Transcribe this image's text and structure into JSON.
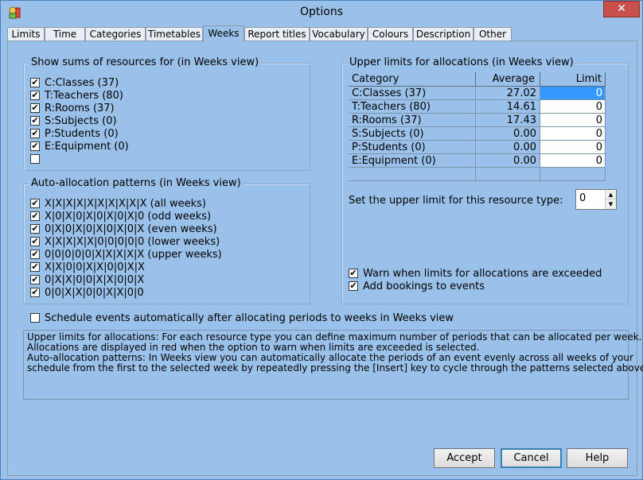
{
  "window": {
    "title": "Options",
    "close_glyph": "✕"
  },
  "tabs": [
    "Limits",
    "Time",
    "Categories",
    "Timetables",
    "Weeks",
    "Report titles",
    "Vocabulary",
    "Colours",
    "Description",
    "Other"
  ],
  "active_tab": "Weeks",
  "sums_group": {
    "title": "Show sums of resources for (in Weeks view)",
    "items": [
      {
        "label": "C:Classes (37)",
        "checked": true
      },
      {
        "label": "T:Teachers (80)",
        "checked": true
      },
      {
        "label": "R:Rooms (37)",
        "checked": true
      },
      {
        "label": "S:Subjects (0)",
        "checked": true
      },
      {
        "label": "P:Students (0)",
        "checked": true
      },
      {
        "label": "E:Equipment (0)",
        "checked": true
      },
      {
        "label": "",
        "checked": false
      }
    ]
  },
  "patterns_group": {
    "title": "Auto-allocation patterns (in Weeks view)",
    "items": [
      {
        "label": "X|X|X|X|X|X|X|X|X|X (all weeks)",
        "checked": true
      },
      {
        "label": "X|0|X|0|X|0|X|0|X|0 (odd weeks)",
        "checked": true
      },
      {
        "label": "0|X|0|X|0|X|0|X|0|X (even weeks)",
        "checked": true
      },
      {
        "label": "X|X|X|X|X|0|0|0|0|0 (lower weeks)",
        "checked": true
      },
      {
        "label": "0|0|0|0|0|X|X|X|X|X (upper weeks)",
        "checked": true
      },
      {
        "label": "X|X|0|0|X|X|0|0|X|X",
        "checked": true
      },
      {
        "label": "0|X|X|0|0|X|X|0|0|X",
        "checked": true
      },
      {
        "label": "0|0|X|X|0|0|X|X|0|0",
        "checked": true
      }
    ]
  },
  "limits_group": {
    "title": "Upper limits for allocations (in Weeks view)",
    "headers": {
      "category": "Category",
      "average": "Average",
      "limit": "Limit"
    },
    "rows": [
      {
        "category": "C:Classes (37)",
        "average": "27.02",
        "limit": "0"
      },
      {
        "category": "T:Teachers (80)",
        "average": "14.61",
        "limit": "0"
      },
      {
        "category": "R:Rooms (37)",
        "average": "17.43",
        "limit": "0"
      },
      {
        "category": "S:Subjects (0)",
        "average": "0.00",
        "limit": "0"
      },
      {
        "category": "P:Students (0)",
        "average": "0.00",
        "limit": "0"
      },
      {
        "category": "E:Equipment (0)",
        "average": "0.00",
        "limit": "0"
      },
      {
        "category": "",
        "average": "",
        "limit": ""
      }
    ],
    "set_limit_label": "Set the upper limit for this resource type:",
    "set_limit_value": "0",
    "warn_label": "Warn when limits for allocations are exceeded",
    "warn_checked": true,
    "bookings_label": "Add bookings to events",
    "bookings_checked": true
  },
  "schedule_auto": {
    "label": "Schedule events automatically after allocating periods to weeks in Weeks view",
    "checked": false
  },
  "help_text": [
    "Upper limits for allocations: For each resource type you can define maximum number of periods that can be allocated per week.",
    "Allocations are displayed in red when the option to warn when limits are exceeded is selected.",
    "Auto-allocation patterns: In Weeks view you can automatically allocate the periods of an event evenly across all weeks of your",
    "schedule from the first to the selected week by repeatedly pressing the [Insert] key to cycle through the patterns selected above."
  ],
  "buttons": {
    "accept": "Accept",
    "cancel": "Cancel",
    "help": "Help"
  },
  "check_glyph": "✔",
  "spin_up_glyph": "▲",
  "spin_down_glyph": "▼"
}
